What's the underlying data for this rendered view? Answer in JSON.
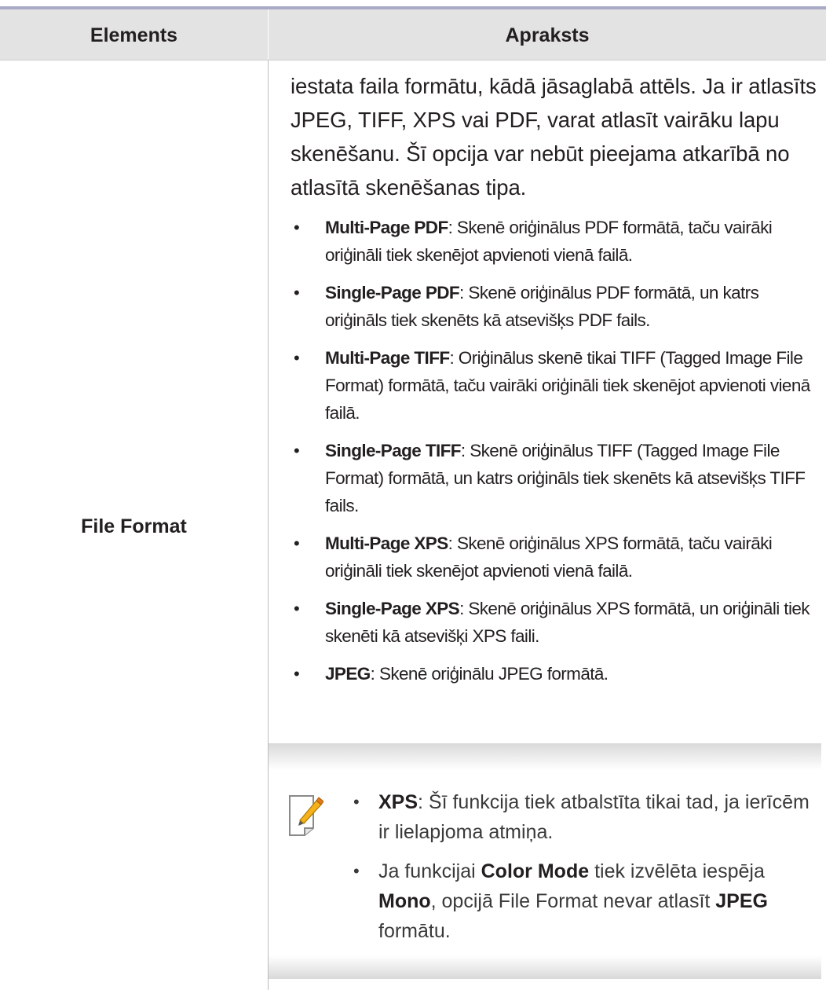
{
  "table": {
    "headers": [
      "Elements",
      "Apraksts"
    ],
    "element": "File Format",
    "intro": "iestata faila formātu, kādā jāsaglabā attēls. Ja ir atlasīts JPEG, TIFF, XPS vai PDF, varat atlasīt vairāku lapu skenēšanu. Šī opcija var nebūt pieejama atkarībā no atlasītā skenēšanas tipa.",
    "options": [
      {
        "term": "Multi-Page PDF",
        "text": ": Skenē oriģinālus PDF formātā, taču vairāki oriģināli tiek skenējot apvienoti vienā failā."
      },
      {
        "term": "Single-Page PDF",
        "text": ": Skenē oriģinālus PDF formātā, un katrs oriģināls tiek skenēts kā atsevišķs PDF fails."
      },
      {
        "term": "Multi-Page TIFF",
        "text": ": Oriģinālus skenē tikai TIFF (Tagged Image File Format) formātā, taču vairāki oriģināli tiek skenējot apvienoti vienā failā."
      },
      {
        "term": "Single-Page TIFF",
        "text": ": Skenē oriģinālus TIFF (Tagged Image File Format) formātā, un katrs oriģināls tiek skenēts kā atsevišķs TIFF fails."
      },
      {
        "term": "Multi-Page XPS",
        "text": ": Skenē oriģinālus XPS formātā, taču vairāki oriģināli tiek skenējot apvienoti vienā failā."
      },
      {
        "term": "Single-Page XPS",
        "text": ": Skenē oriģinālus XPS formātā, un oriģināli tiek skenēti kā atsevišķi XPS faili."
      },
      {
        "term": "JPEG",
        "text": ": Skenē oriģinālu JPEG formātā."
      }
    ],
    "bullet": "•"
  },
  "note": {
    "icon": "note-pencil-icon",
    "item1": {
      "term": "XPS",
      "text": ": Šī funkcija tiek atbalstīta tikai tad, ja ierīcēm ir lielapjoma atmiņa."
    },
    "item2": {
      "p1": "Ja funkcijai ",
      "b1": "Color Mode",
      "p2": " tiek izvēlēta iespēja ",
      "b2": "Mono",
      "p3": ", opcijā File Format nevar atlasīt ",
      "b3": "JPEG",
      "p4": " formātu."
    }
  }
}
